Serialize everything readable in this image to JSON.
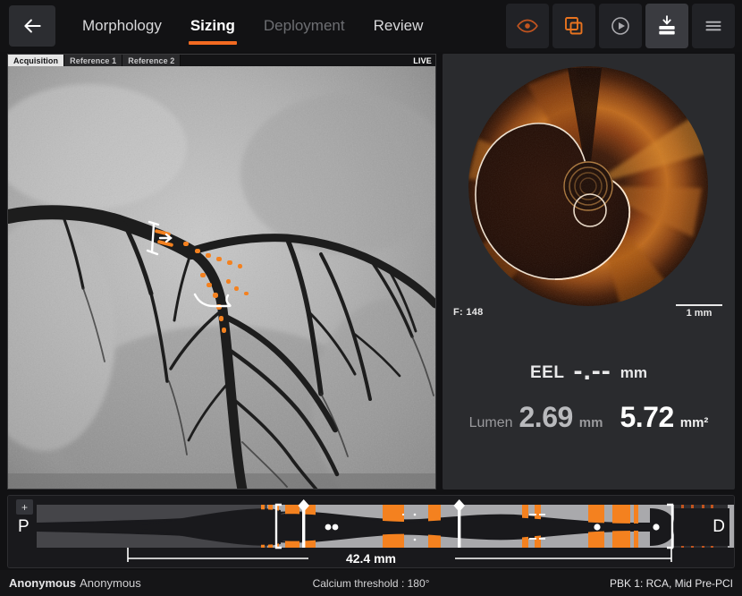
{
  "header": {
    "back_icon": "back-arrow-icon",
    "tabs": [
      {
        "label": "Morphology",
        "state": "inactive"
      },
      {
        "label": "Sizing",
        "state": "active"
      },
      {
        "label": "Deployment",
        "state": "disabled"
      },
      {
        "label": "Review",
        "state": "inactive"
      }
    ],
    "tools": [
      {
        "name": "eye-icon",
        "label": "Visibility",
        "active": false,
        "color": "#c2541f"
      },
      {
        "name": "layers-icon",
        "label": "Co-registration",
        "active": false,
        "color": "#e8731f"
      },
      {
        "name": "play-icon",
        "label": "Play",
        "active": false,
        "color": "#a9a9ad"
      },
      {
        "name": "save-icon",
        "label": "Save",
        "active": true,
        "color": "#ffffff"
      },
      {
        "name": "menu-icon",
        "label": "Menu",
        "active": false,
        "color": "#b6b6ba"
      }
    ]
  },
  "angio": {
    "tabs": [
      {
        "label": "Acquisition",
        "active": true
      },
      {
        "label": "Reference 1",
        "active": false
      },
      {
        "label": "Reference 2",
        "active": false
      }
    ],
    "live_badge": "LIVE"
  },
  "oct": {
    "frame_label": "F: 148",
    "scale_label": "1 mm",
    "eel": {
      "label": "EEL",
      "value": "-.--",
      "unit": "mm"
    },
    "lumen": {
      "label": "Lumen",
      "diameter": "2.69",
      "diameter_unit": "mm",
      "area": "5.72",
      "area_unit": "mm²"
    }
  },
  "longitudinal": {
    "zoom_button": "+",
    "proximal_label": "P",
    "distal_label": "D",
    "length_measure": "42.4  mm"
  },
  "status": {
    "patient_last": "Anonymous",
    "patient_first": "Anonymous",
    "calcium_threshold": "Calcium threshold :  180°",
    "procedure": "PBK 1: RCA,  Mid  Pre-PCI"
  },
  "colors": {
    "accent_orange": "#f26a21",
    "calcium_orange": "#f4811f",
    "panel_bg": "#2a2b2e",
    "header_bg": "#121214"
  }
}
